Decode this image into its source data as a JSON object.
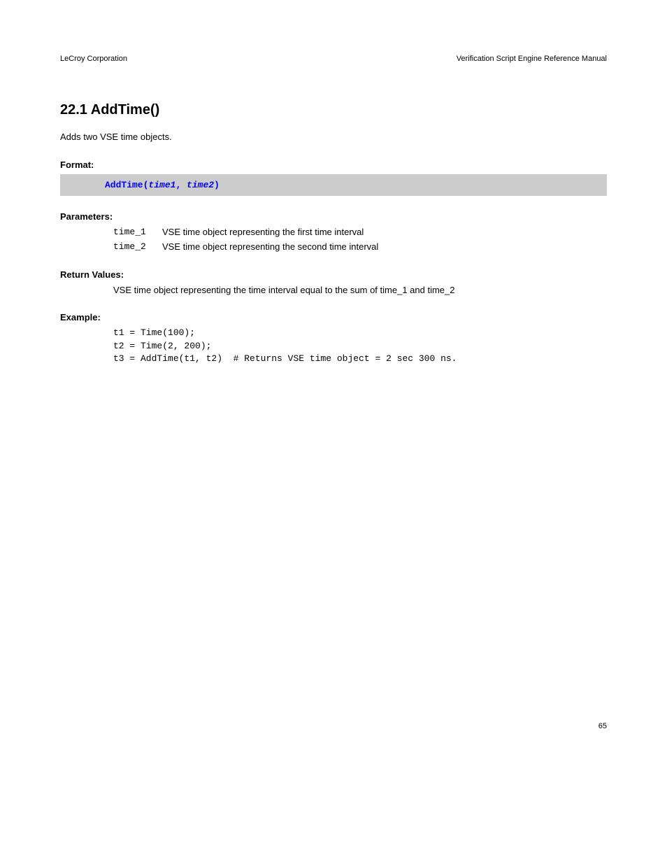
{
  "header": {
    "left": "LeCroy Corporation",
    "right": "Verification Script Engine Reference Manual"
  },
  "section": {
    "number": "22.1",
    "title": "AddTime()"
  },
  "intro": "Adds two VSE time objects.",
  "format_label": "Format:",
  "code_banner": {
    "fn": "AddTime(",
    "a1": "time1",
    "sep": ", ",
    "a2": "time2",
    "end": ")"
  },
  "parameters_label": "Parameters:",
  "params": [
    {
      "name": "time_1",
      "desc": "VSE time object representing the first time interval"
    },
    {
      "name": "time_2",
      "desc": "VSE time object representing the second time interval"
    }
  ],
  "return_label": "Return Values:",
  "return_text": "VSE time object representing the time interval equal to the sum of time_1 and time_2",
  "example_label": "Example:",
  "example_code": "t1 = Time(100);\nt2 = Time(2, 200);\nt3 = AddTime(t1, t2)  # Returns VSE time object = 2 sec 300 ns.",
  "page_number": "65"
}
